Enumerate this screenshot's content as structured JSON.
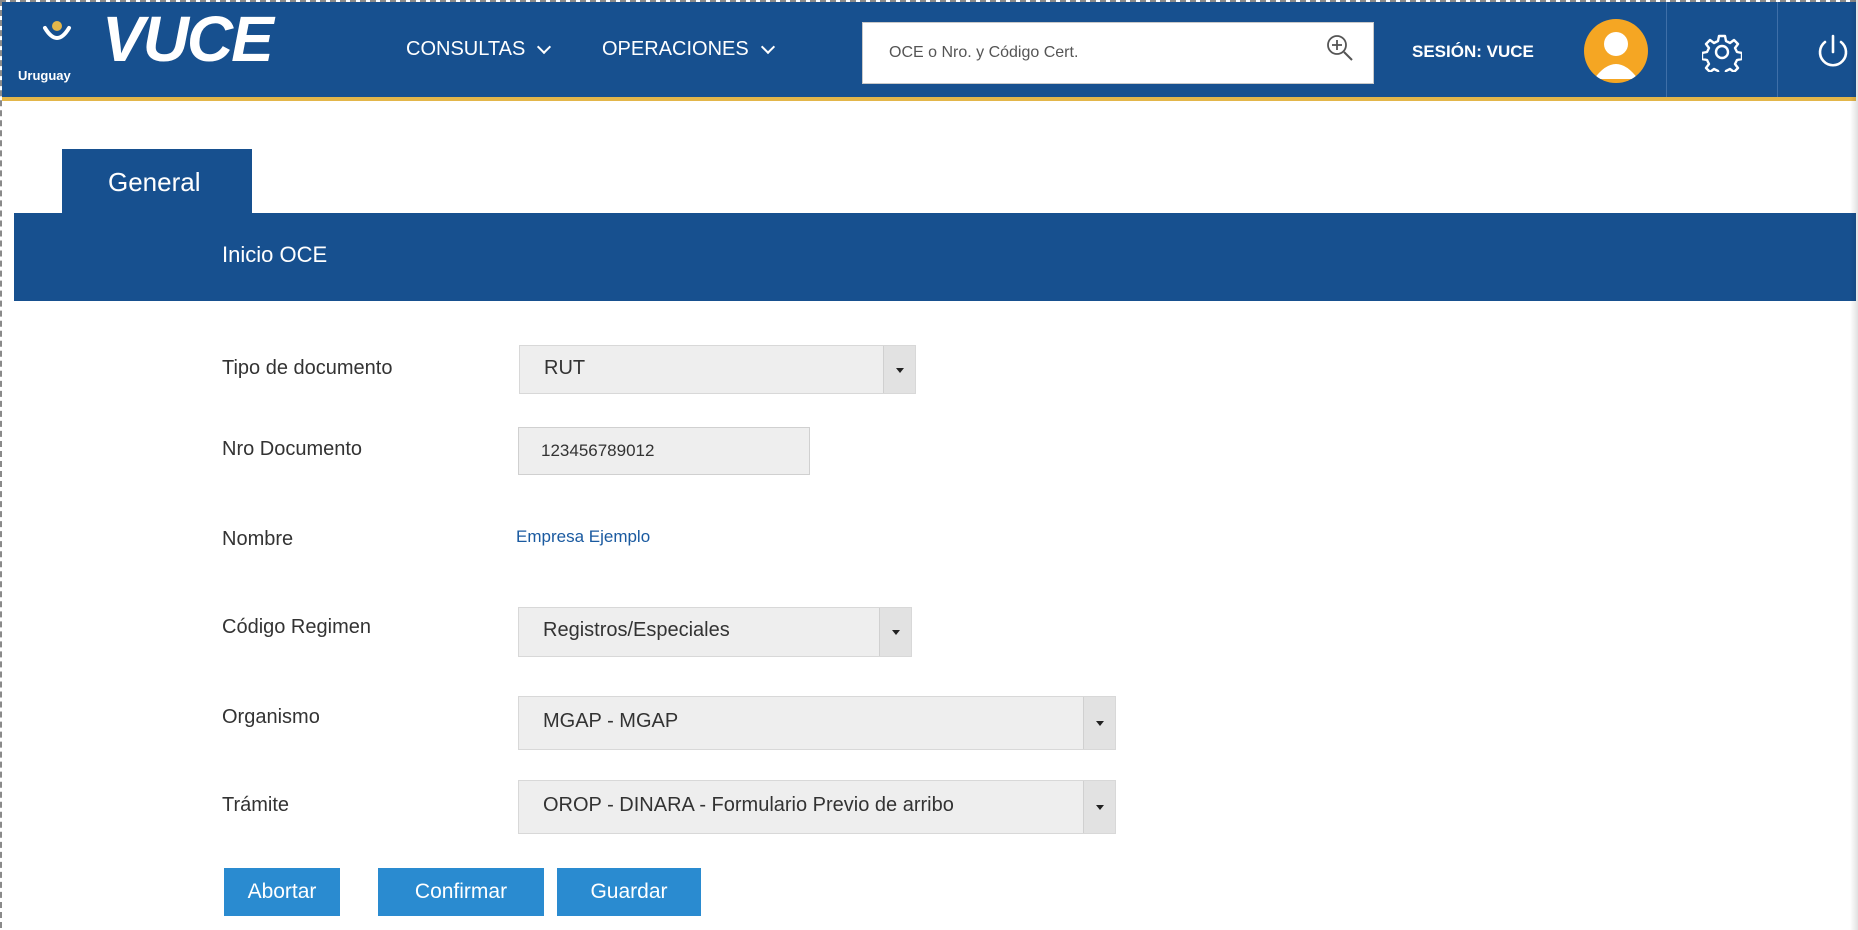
{
  "header": {
    "logo": {
      "word": "VUCE",
      "country": "Uruguay"
    },
    "nav": [
      {
        "label": "CONSULTAS"
      },
      {
        "label": "OPERACIONES"
      }
    ],
    "search": {
      "placeholder": "OCE o Nro. y Código Cert.",
      "value": ""
    },
    "session_label": "SESIÓN: VUCE",
    "icons": {
      "search": "zoom-in-icon",
      "avatar": "user-avatar-icon",
      "settings": "gear-icon",
      "power": "power-icon"
    },
    "colors": {
      "bar": "#17508f",
      "accent": "#e3b64a",
      "avatar": "#f5a623"
    }
  },
  "tabs": [
    {
      "label": "General",
      "active": true
    }
  ],
  "section": {
    "title": "Inicio OCE"
  },
  "form": {
    "tipo_documento": {
      "label": "Tipo de documento",
      "value": "RUT"
    },
    "nro_documento": {
      "label": "Nro Documento",
      "value": "123456789012"
    },
    "nombre": {
      "label": "Nombre",
      "value": "Empresa Ejemplo"
    },
    "codigo_regimen": {
      "label": "Código Regimen",
      "value": "Registros/Especiales"
    },
    "organismo": {
      "label": "Organismo",
      "value": "MGAP - MGAP"
    },
    "tramite": {
      "label": "Trámite",
      "value": "OROP - DINARA - Formulario Previo de arribo"
    }
  },
  "actions": {
    "abortar": "Abortar",
    "confirmar": "Confirmar",
    "guardar": "Guardar"
  }
}
